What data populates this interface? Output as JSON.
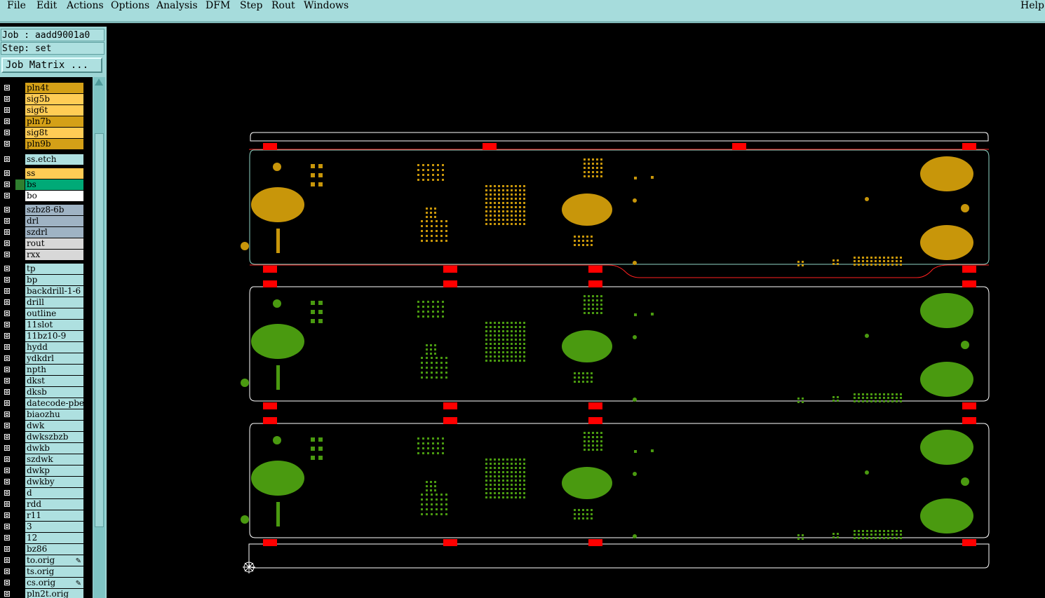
{
  "menu": {
    "file": "File",
    "edit": "Edit",
    "actions": "Actions",
    "options": "Options",
    "analysis": "Analysis",
    "dfm": "DFM",
    "step": "Step",
    "rout": "Rout",
    "windows": "Windows",
    "help": "Help"
  },
  "job": {
    "label": "Job : aadd9001a0",
    "step": "Step: set",
    "matrix_button": "Job Matrix ..."
  },
  "layers": [
    {
      "name": "pln4t",
      "color": "#d4a017"
    },
    {
      "name": "sig5b",
      "color": "#ffcc55"
    },
    {
      "name": "sig6t",
      "color": "#ffcc55"
    },
    {
      "name": "pln7b",
      "color": "#d4a017"
    },
    {
      "name": "sig8t",
      "color": "#ffcc55"
    },
    {
      "name": "pln9b",
      "color": "#d4a017"
    },
    {
      "name": "ss.etch",
      "color": "#aee0e0"
    },
    {
      "name": "ss",
      "color": "#ffcc55"
    },
    {
      "name": "bs",
      "color": "#00aa77"
    },
    {
      "name": "bo",
      "color": "#ffffff"
    },
    {
      "name": "szbz8-6b",
      "color": "#9fb3c4"
    },
    {
      "name": "drl",
      "color": "#9fb3c4"
    },
    {
      "name": "szdrl",
      "color": "#9fb3c4"
    },
    {
      "name": "rout",
      "color": "#d8d8d8"
    },
    {
      "name": "rxx",
      "color": "#d8d8d8"
    },
    {
      "name": "tp",
      "color": "#aee0e0"
    },
    {
      "name": "bp",
      "color": "#aee0e0"
    },
    {
      "name": "backdrill-1-6",
      "color": "#aee0e0"
    },
    {
      "name": "drill",
      "color": "#aee0e0"
    },
    {
      "name": "outline",
      "color": "#aee0e0"
    },
    {
      "name": "11slot",
      "color": "#aee0e0"
    },
    {
      "name": "11bz10-9",
      "color": "#aee0e0"
    },
    {
      "name": "hydd",
      "color": "#aee0e0"
    },
    {
      "name": "ydkdrl",
      "color": "#aee0e0"
    },
    {
      "name": "npth",
      "color": "#aee0e0"
    },
    {
      "name": "dkst",
      "color": "#aee0e0"
    },
    {
      "name": "dksb",
      "color": "#aee0e0"
    },
    {
      "name": "datecode-pbe",
      "color": "#aee0e0"
    },
    {
      "name": "biaozhu",
      "color": "#aee0e0"
    },
    {
      "name": "dwk",
      "color": "#aee0e0"
    },
    {
      "name": "dwkszbzb",
      "color": "#aee0e0"
    },
    {
      "name": "dwkb",
      "color": "#aee0e0"
    },
    {
      "name": "szdwk",
      "color": "#aee0e0"
    },
    {
      "name": "dwkp",
      "color": "#aee0e0"
    },
    {
      "name": "dwkby",
      "color": "#aee0e0"
    },
    {
      "name": "d",
      "color": "#aee0e0"
    },
    {
      "name": "rdd",
      "color": "#aee0e0"
    },
    {
      "name": "r11",
      "color": "#aee0e0"
    },
    {
      "name": "3",
      "color": "#aee0e0"
    },
    {
      "name": "12",
      "color": "#aee0e0"
    },
    {
      "name": "bz86",
      "color": "#aee0e0"
    },
    {
      "name": "to.orig",
      "color": "#aee0e0"
    },
    {
      "name": "ts.orig",
      "color": "#aee0e0"
    },
    {
      "name": "cs.orig",
      "color": "#aee0e0"
    },
    {
      "name": "pln2t.orig",
      "color": "#aee0e0"
    }
  ],
  "colors": {
    "menubar": "#a6dcdc",
    "panel": "#9ed6d6",
    "silk_top": "#c8960a",
    "silk_bottom": "#4a9a10",
    "fiducial": "#ff0000",
    "outline": "#ffffff",
    "selected": "#ff2020"
  },
  "icons": {
    "origin": "crosshair-origin-icon",
    "layer_flag": "pencil-icon"
  }
}
